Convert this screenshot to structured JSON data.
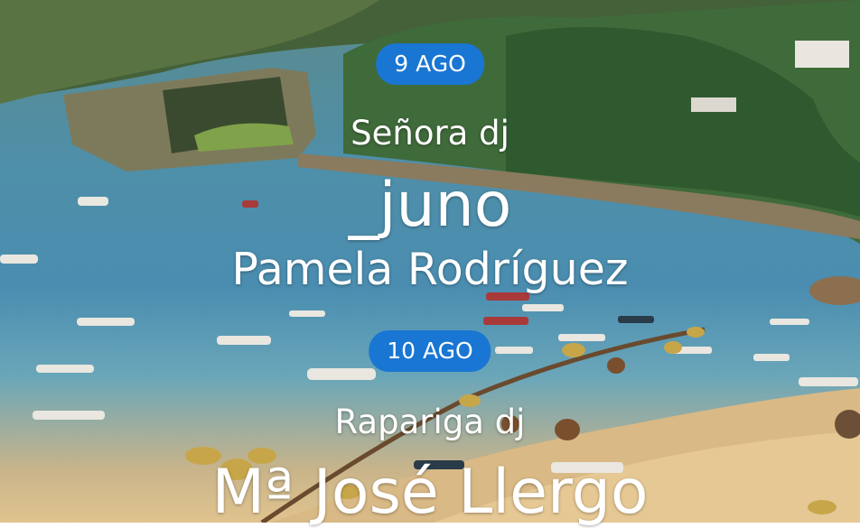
{
  "events": [
    {
      "date": "9 AGO",
      "lines": [
        "Señora dj",
        "_juno",
        "Pamela Rodríguez"
      ]
    },
    {
      "date": "10 AGO",
      "lines": [
        "Rapariga dj",
        "Mª José Llergo"
      ]
    }
  ],
  "colors": {
    "pill": "#1976d2",
    "text": "#ffffff",
    "water": "#4a8db0",
    "sand": "#e0c48f",
    "forest": "#3f6a3a"
  }
}
